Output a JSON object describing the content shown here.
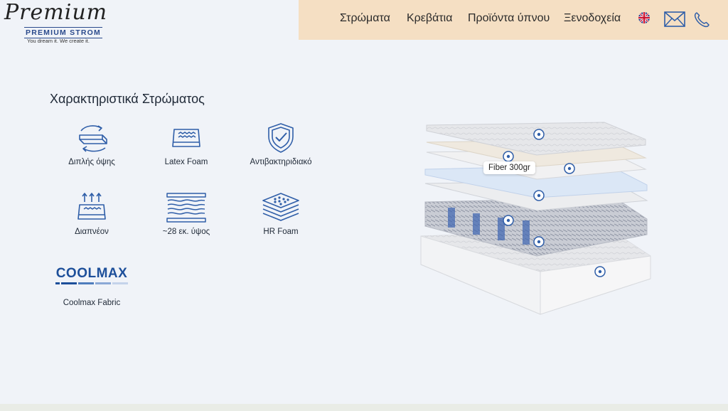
{
  "logo": {
    "script_text": "Premium",
    "brand": "PREMIUM STROM",
    "tagline": "You dream it. We create it."
  },
  "nav": {
    "items": [
      "Στρώματα",
      "Κρεβάτια",
      "Προϊόντα ύπνου",
      "Ξενοδοχεία"
    ],
    "language_icon": "uk-flag-icon",
    "mail_icon": "mail-icon",
    "phone_icon": "phone-icon"
  },
  "features": {
    "title": "Χαρακτηριστικά Στρώματος",
    "items": [
      {
        "label": "Διπλής όψης",
        "icon": "double-sided-icon"
      },
      {
        "label": "Latex Foam",
        "icon": "latex-foam-icon"
      },
      {
        "label": "Αντιβακτηριδιακό",
        "icon": "antibacterial-shield-icon"
      },
      {
        "label": "Διαπνέον",
        "icon": "breathable-icon"
      },
      {
        "label": "~28 εκ. ύψος",
        "icon": "height-layers-icon"
      },
      {
        "label": "HR Foam",
        "icon": "hr-foam-icon"
      }
    ],
    "coolmax": {
      "logo_text": "COOLMAX",
      "label": "Coolmax Fabric"
    }
  },
  "mattress": {
    "tooltip": "Fiber 300gr"
  },
  "colors": {
    "nav_bg": "#f5dfc3",
    "page_bg": "#f0f3f8",
    "icon_blue": "#2f5ea8"
  }
}
